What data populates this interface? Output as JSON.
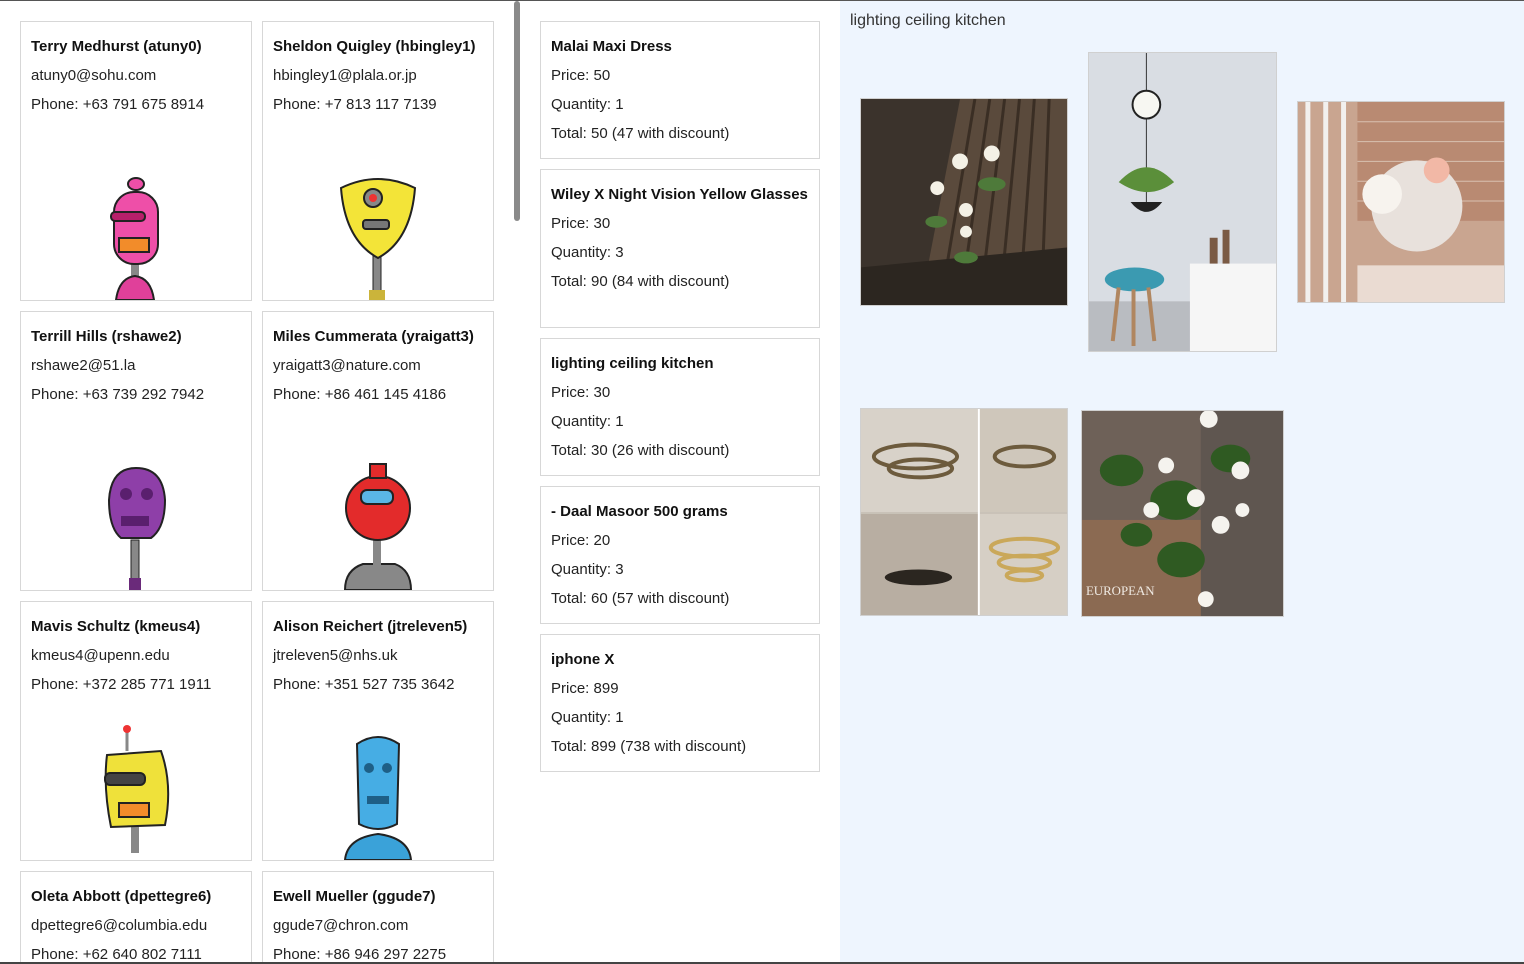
{
  "users": [
    {
      "name": "Terry Medhurst (atuny0)",
      "email": "atuny0@sohu.com",
      "phone": "Phone: +63 791 675 8914"
    },
    {
      "name": "Sheldon Quigley (hbingley1)",
      "email": "hbingley1@plala.or.jp",
      "phone": "Phone: +7 813 117 7139"
    },
    {
      "name": "Terrill Hills (rshawe2)",
      "email": "rshawe2@51.la",
      "phone": "Phone: +63 739 292 7942"
    },
    {
      "name": "Miles Cummerata (yraigatt3)",
      "email": "yraigatt3@nature.com",
      "phone": "Phone: +86 461 145 4186"
    },
    {
      "name": "Mavis Schultz (kmeus4)",
      "email": "kmeus4@upenn.edu",
      "phone": "Phone: +372 285 771 1911"
    },
    {
      "name": "Alison Reichert (jtreleven5)",
      "email": "jtreleven5@nhs.uk",
      "phone": "Phone: +351 527 735 3642"
    },
    {
      "name": "Oleta Abbott (dpettegre6)",
      "email": "dpettegre6@columbia.edu",
      "phone": "Phone: +62 640 802 7111"
    },
    {
      "name": "Ewell Mueller (ggude7)",
      "email": "ggude7@chron.com",
      "phone": "Phone: +86 946 297 2275"
    }
  ],
  "orders": [
    {
      "title": "Malai Maxi Dress",
      "price": "Price: 50",
      "quantity": "Quantity: 1",
      "total": "Total: 50 (47 with discount)"
    },
    {
      "title": "Wiley X Night Vision Yellow Glasses",
      "price": "Price: 30",
      "quantity": "Quantity: 3",
      "total": "Total: 90 (84 with discount)"
    },
    {
      "title": "lighting ceiling kitchen",
      "price": "Price: 30",
      "quantity": "Quantity: 1",
      "total": "Total: 30 (26 with discount)"
    },
    {
      "title": "- Daal Masoor 500 grams",
      "price": "Price: 20",
      "quantity": "Quantity: 3",
      "total": "Total: 60 (57 with discount)"
    },
    {
      "title": "iphone X",
      "price": "Price: 899",
      "quantity": "Quantity: 1",
      "total": "Total: 899 (738 with discount)"
    }
  ],
  "product": {
    "title": "lighting ceiling kitchen",
    "watermark": "EUROPEAN"
  },
  "colors": {
    "product_bg": "#eef5fe",
    "card_border": "#d7d7d7"
  }
}
